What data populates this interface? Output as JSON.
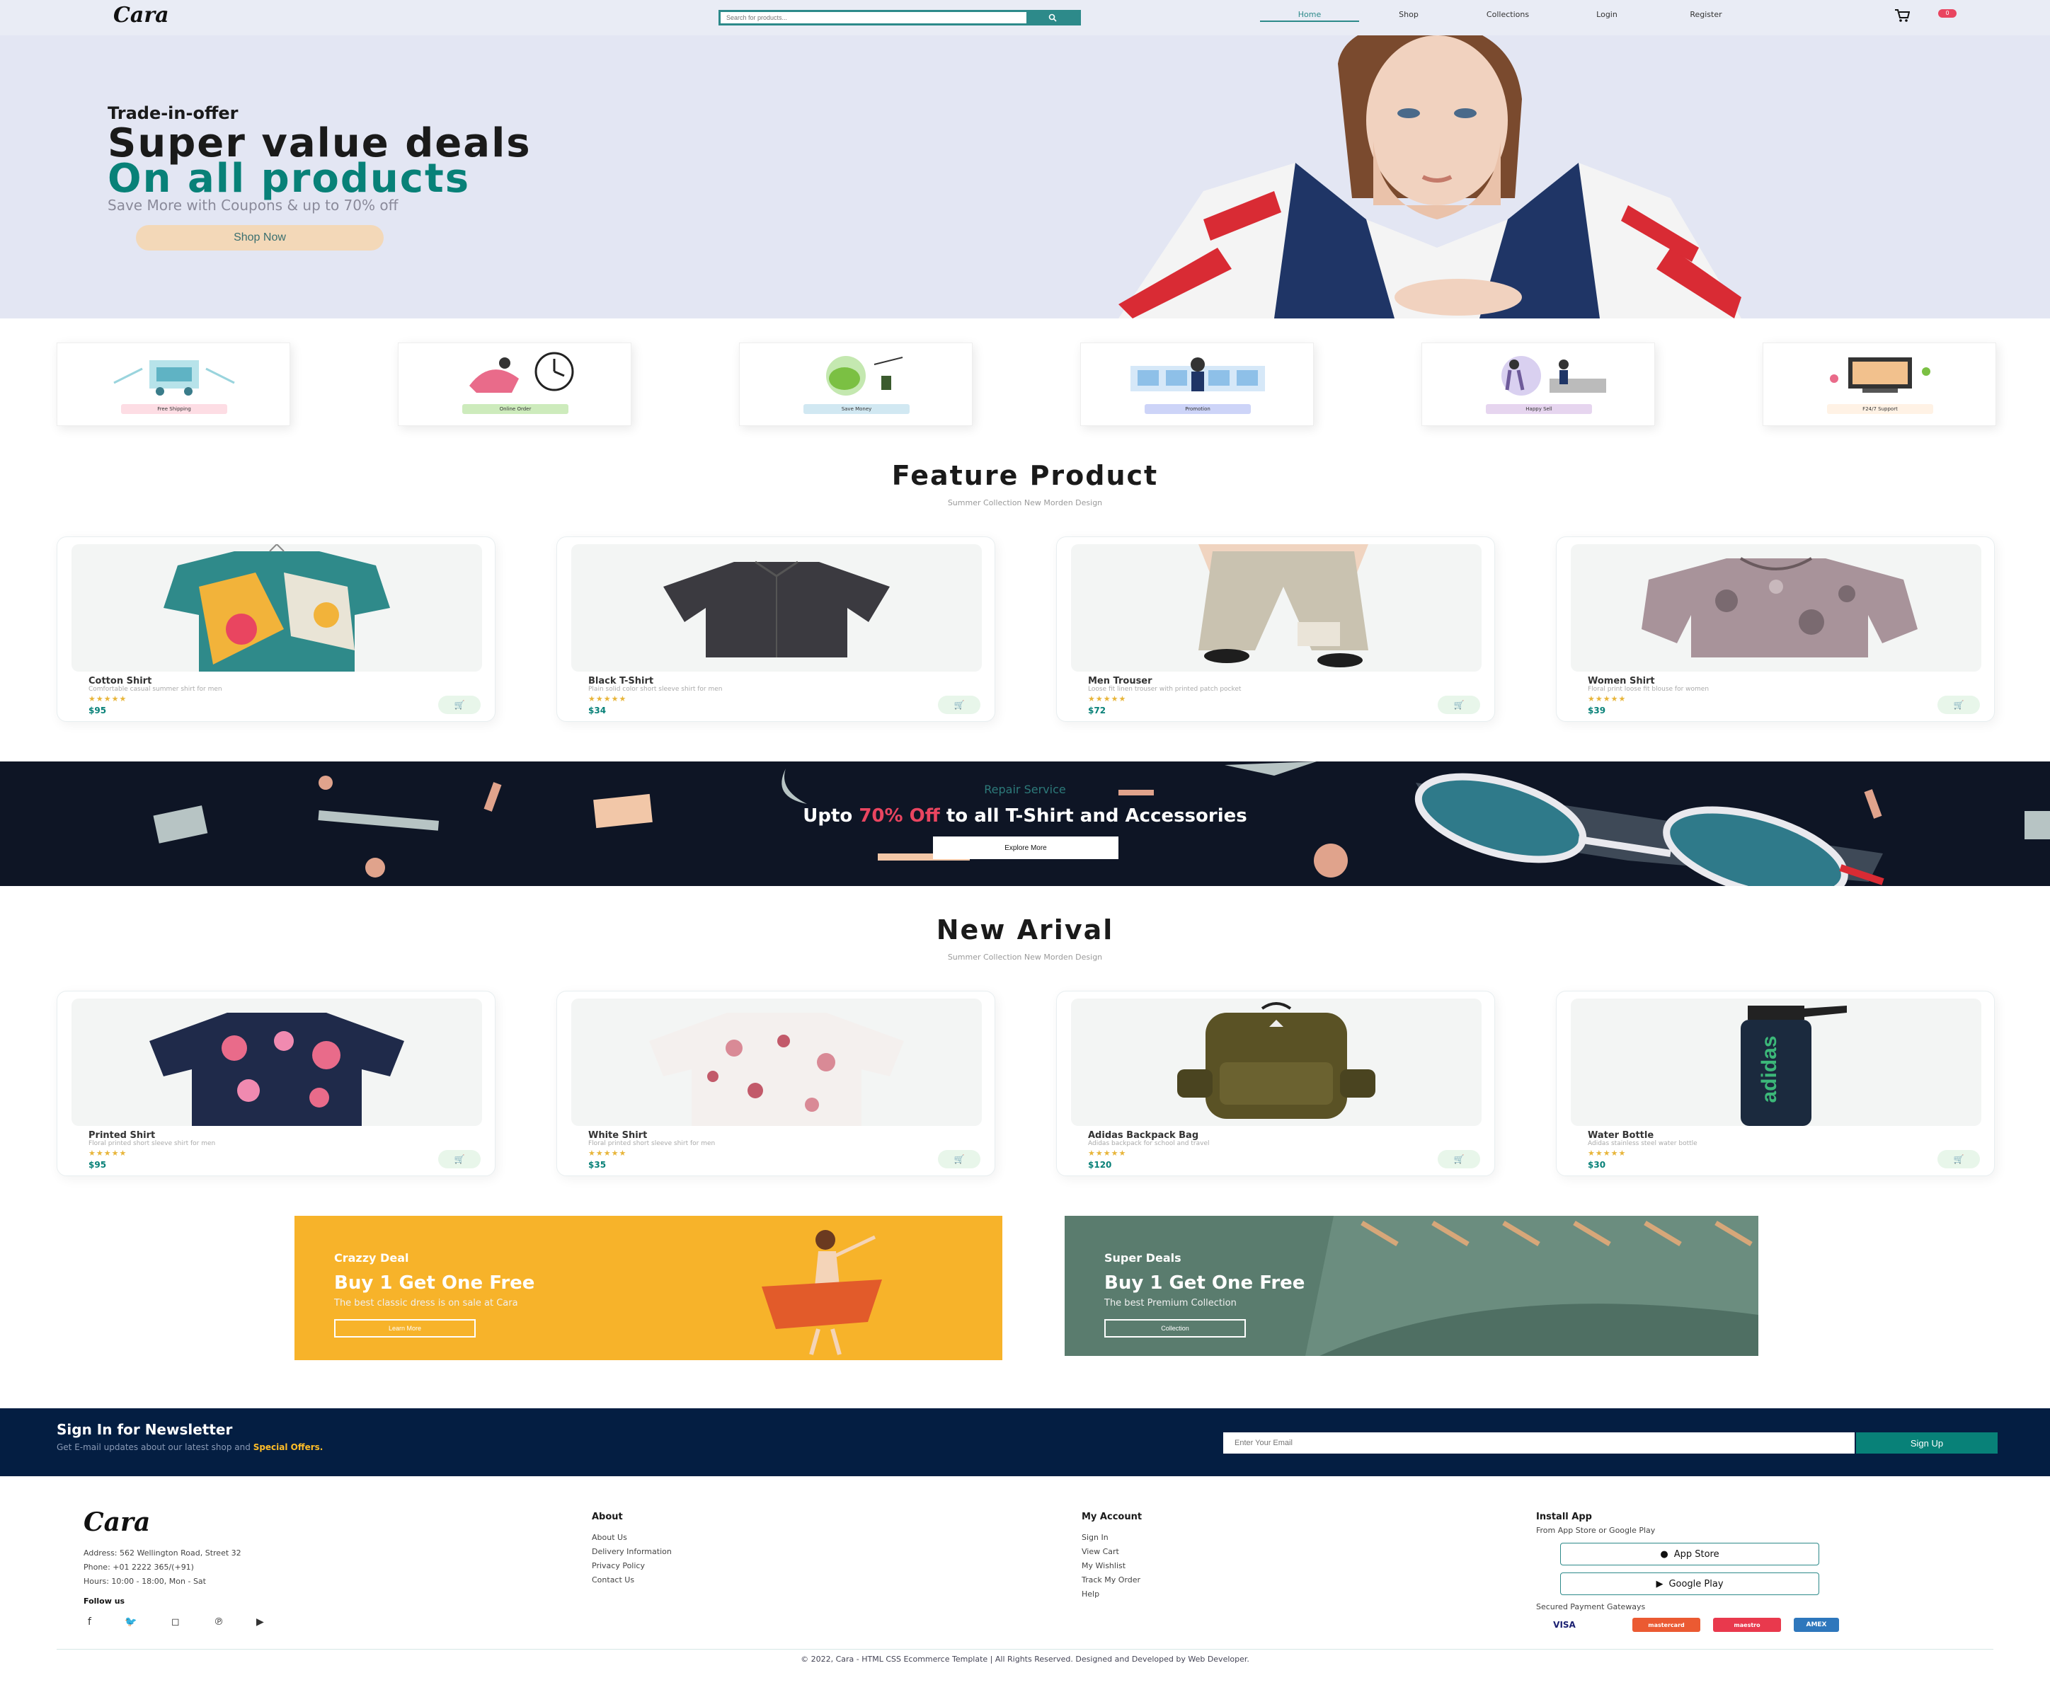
{
  "header": {
    "logo": "Cara",
    "search_placeholder": "Search for products...",
    "search_icon": "search-icon",
    "nav": [
      "Home",
      "Shop",
      "Collections",
      "Login",
      "Register"
    ],
    "active_nav": "Home",
    "cart_icon": "cart-icon",
    "cart_count": "0"
  },
  "hero": {
    "eyebrow": "Trade-in-offer",
    "title_line1": "Super value deals",
    "title_line2": "On all products",
    "subtitle": "Save More with Coupons & up to 70% off",
    "button": "Shop Now"
  },
  "features": [
    "Free Shipping",
    "Online Order",
    "Save Money",
    "Promotion",
    "Happy Sell",
    "F24/7 Support"
  ],
  "featured": {
    "title": "Feature Product",
    "subtitle": "Summer Collection New Morden Design",
    "products": [
      {
        "name": "Cotton Shirt",
        "desc": "Comfortable casual summer shirt for men",
        "price": "$95"
      },
      {
        "name": "Black T-Shirt",
        "desc": "Plain solid color short sleeve shirt for men",
        "price": "$34"
      },
      {
        "name": "Men Trouser",
        "desc": "Loose fit linen trouser with printed patch pocket",
        "price": "$72"
      },
      {
        "name": "Women Shirt",
        "desc": "Floral print loose fit blouse for women",
        "price": "$39"
      }
    ]
  },
  "repair": {
    "eyebrow": "Repair Service",
    "title_before": "Upto ",
    "title_highlight": "70% Off",
    "title_after": " to all T-Shirt and Accessories",
    "button": "Explore More"
  },
  "arrivals": {
    "title": "New Arival",
    "subtitle": "Summer Collection New Morden Design",
    "products": [
      {
        "name": "Printed Shirt",
        "desc": "Floral printed short sleeve shirt for men",
        "price": "$95"
      },
      {
        "name": "White Shirt",
        "desc": "Floral printed short sleeve shirt for men",
        "price": "$35"
      },
      {
        "name": "Adidas Backpack Bag",
        "desc": "Adidas backpack for school and travel",
        "price": "$120"
      },
      {
        "name": "Water Bottle",
        "desc": "Adidas stainless steel water bottle",
        "price": "$30"
      }
    ]
  },
  "banners": [
    {
      "eyebrow": "Crazzy Deal",
      "title": "Buy 1 Get One Free",
      "text": "The best classic dress is on sale at Cara",
      "button": "Learn More",
      "color": "#f7b32a"
    },
    {
      "eyebrow": "Super Deals",
      "title": "Buy 1 Get One Free",
      "text": "The best Premium Collection",
      "button": "Collection",
      "color": "#5a7c6e"
    }
  ],
  "newsletter": {
    "title": "Sign In for Newsletter",
    "text_before": "Get E-mail updates about our latest shop and ",
    "text_highlight": "Special Offers.",
    "placeholder": "Enter Your Email",
    "button": "Sign Up"
  },
  "footer": {
    "logo": "Cara",
    "contact": [
      "Address: 562 Wellington Road, Street 32",
      "Phone: +01 2222 365/(+91)",
      "Hours: 10:00 - 18:00, Mon - Sat"
    ],
    "follow_title": "Follow us",
    "social_icons": [
      "facebook-icon",
      "twitter-icon",
      "instagram-icon",
      "pinterest-icon",
      "youtube-icon"
    ],
    "about_title": "About",
    "about_links": [
      "About Us",
      "Delivery Information",
      "Privacy Policy",
      "Contact Us"
    ],
    "account_title": "My Account",
    "account_links": [
      "Sign In",
      "View Cart",
      "My Wishlist",
      "Track My Order",
      "Help"
    ],
    "install_title": "Install App",
    "install_text": "From App Store or Google Play",
    "app_store": "App Store",
    "google_play": "Google Play",
    "payment_title": "Secured Payment Gateways",
    "payments": [
      "VISA",
      "mastercard",
      "maestro",
      "AMEX"
    ],
    "copyright": "© 2022, Cara - HTML CSS Ecommerce Template | All Rights Reserved. Designed and Developed by Web Developer."
  }
}
